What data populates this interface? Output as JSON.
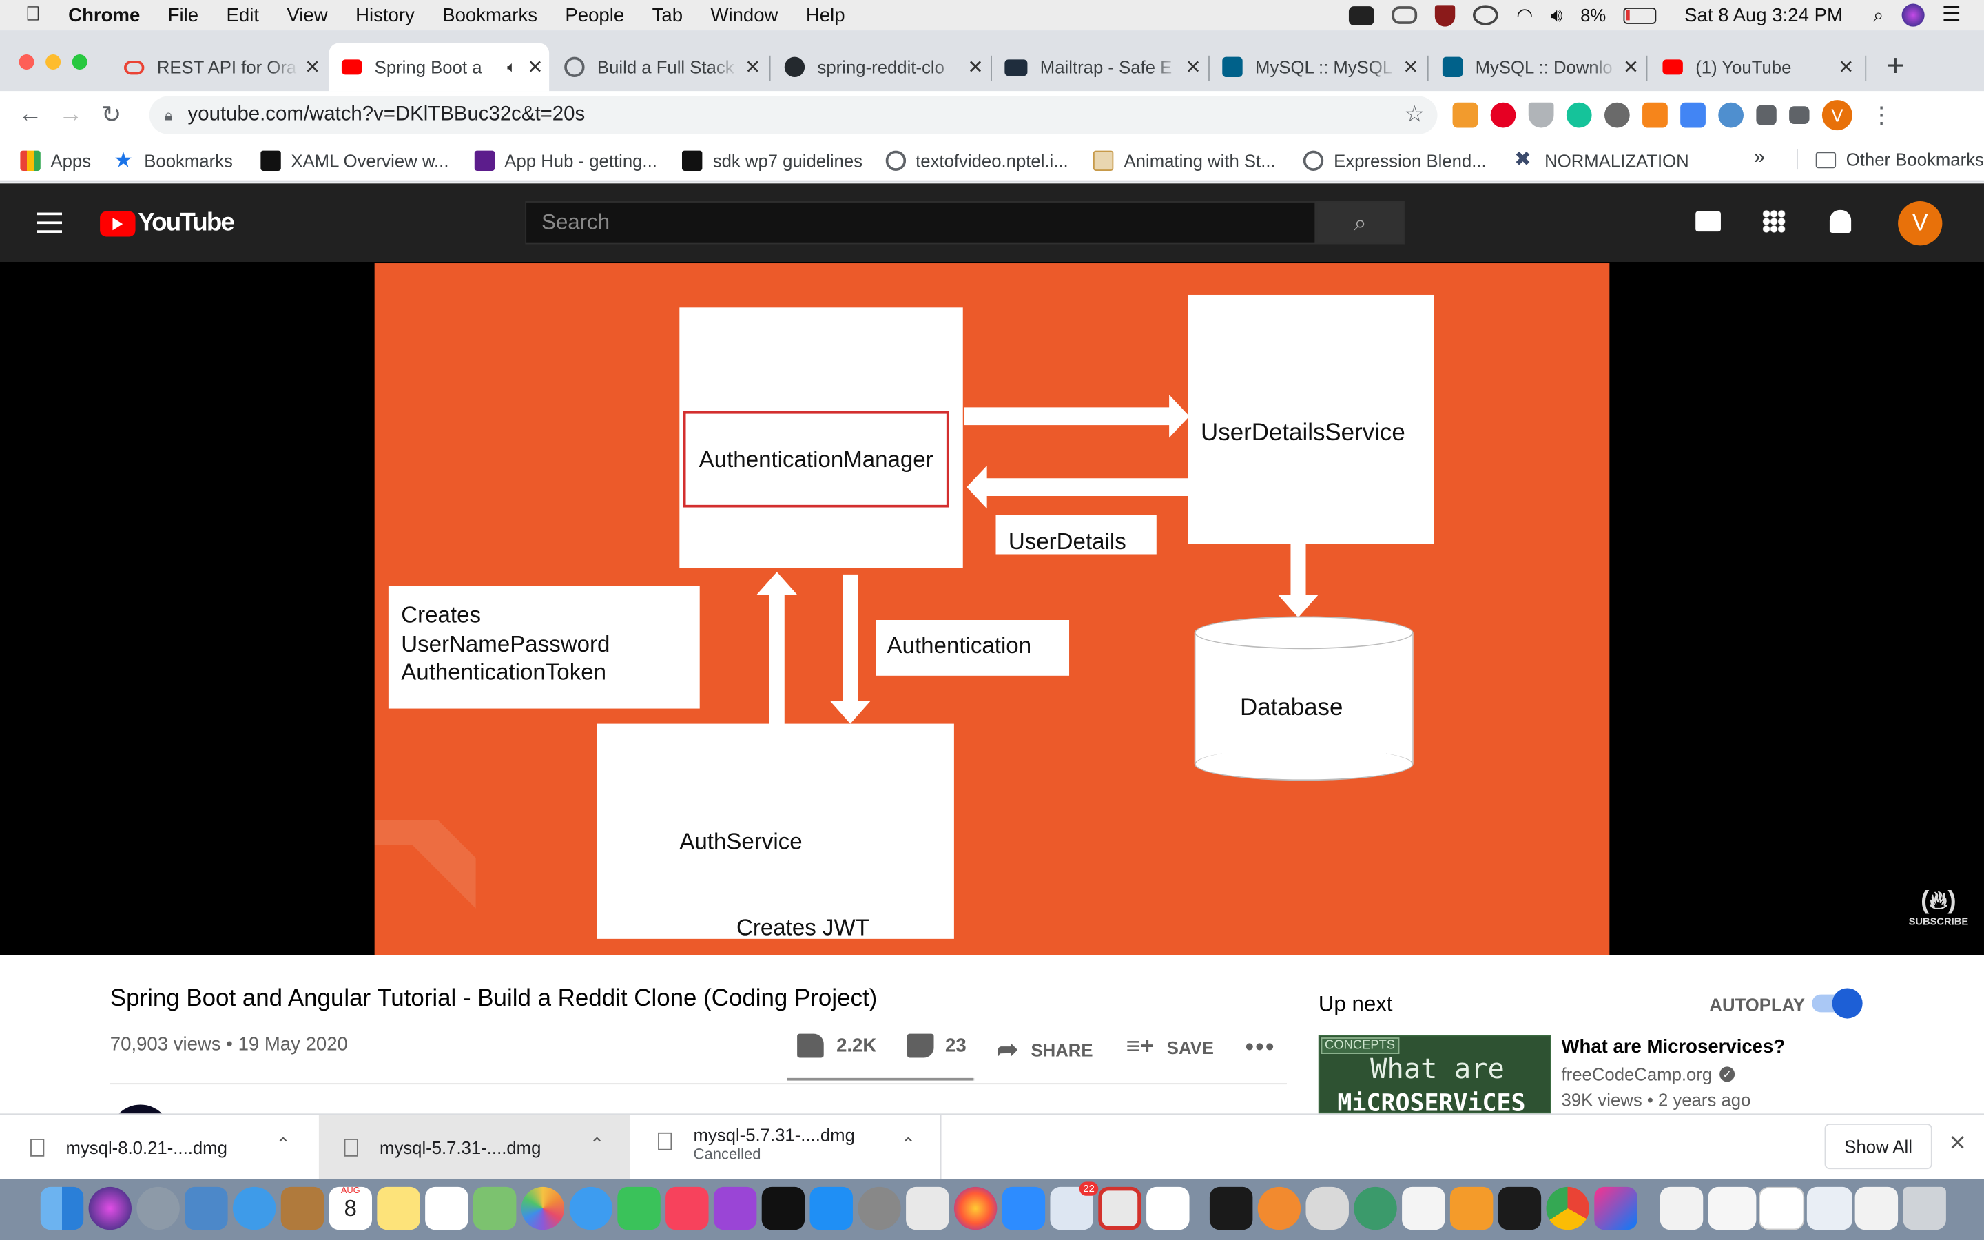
{
  "menubar": {
    "app": "Chrome",
    "items": [
      "File",
      "Edit",
      "View",
      "History",
      "Bookmarks",
      "People",
      "Tab",
      "Window",
      "Help"
    ],
    "battery": "8%",
    "datetime": "Sat 8 Aug  3:24 PM"
  },
  "tabs": [
    {
      "title": "REST API for Ora",
      "color": "#ea4335"
    },
    {
      "title": "Spring Boot a",
      "color": "#ff0000"
    },
    {
      "title": "Build a Full Stack",
      "color": "#5f6368"
    },
    {
      "title": "spring-reddit-clo",
      "color": "#24292e"
    },
    {
      "title": "Mailtrap - Safe E",
      "color": "#1f2d3d"
    },
    {
      "title": "MySQL :: MySQL",
      "color": "#00618a"
    },
    {
      "title": "MySQL :: Downlo",
      "color": "#00618a"
    },
    {
      "title": "(1) YouTube",
      "color": "#ff0000"
    }
  ],
  "omnibox": {
    "url": "youtube.com/watch?v=DKlTBBuc32c&t=20s"
  },
  "profile_initial": "V",
  "bookmarks": [
    {
      "label": "Apps",
      "color": "#4285f4"
    },
    {
      "label": "Bookmarks",
      "color": "#1a73e8"
    },
    {
      "label": "XAML Overview w...",
      "color": "#111111"
    },
    {
      "label": "App Hub - getting...",
      "color": "#5c1d8c"
    },
    {
      "label": "sdk wp7 guidelines",
      "color": "#111111"
    },
    {
      "label": "textofvideo.nptel.i...",
      "color": "#5f6368"
    },
    {
      "label": "Animating with St...",
      "color": "#c79a4a"
    },
    {
      "label": "Expression Blend...",
      "color": "#5f6368"
    },
    {
      "label": "NORMALIZATION",
      "color": "#3b4a6b"
    }
  ],
  "bookmarks_overflow": "»",
  "other_bookmarks": "Other Bookmarks",
  "youtube": {
    "logo_text": "YouTube",
    "search_placeholder": "Search",
    "avatar": "V"
  },
  "slide": {
    "auth_manager": "AuthenticationManager",
    "user_details_service": "UserDetailsService",
    "user_details": "UserDetails",
    "creates_token": [
      "Creates",
      "UserNamePassword",
      "AuthenticationToken"
    ],
    "authentication": "Authentication",
    "database": "Database",
    "auth_service": "AuthService",
    "creates_jwt": "Creates JWT",
    "subscribe": "SUBSCRIBE"
  },
  "video": {
    "title": "Spring Boot and Angular Tutorial - Build a Reddit Clone (Coding Project)",
    "meta": "70,903 views • 19 May 2020",
    "likes": "2.2K",
    "dislikes": "23",
    "share": "SHARE",
    "save": "SAVE",
    "likes_ratio": 0.99
  },
  "upnext": {
    "heading": "Up next",
    "autoplay": "AUTOPLAY",
    "autoplay_on": true,
    "item": {
      "badge": "CONCEPTS",
      "thumb_text": "What are",
      "thumb_text2": "MiCROSERViCES",
      "title": "What are Microservices?",
      "channel": "freeCodeCamp.org",
      "meta": "39K views • 2 years ago"
    }
  },
  "downloads": [
    {
      "name": "mysql-8.0.21-....dmg",
      "status": ""
    },
    {
      "name": "mysql-5.7.31-....dmg",
      "status": ""
    },
    {
      "name": "mysql-5.7.31-....dmg",
      "status": "Cancelled"
    }
  ],
  "show_all": "Show All",
  "dock": {
    "calendar_month": "AUG",
    "calendar_day": "8",
    "mail_badge": "22"
  }
}
